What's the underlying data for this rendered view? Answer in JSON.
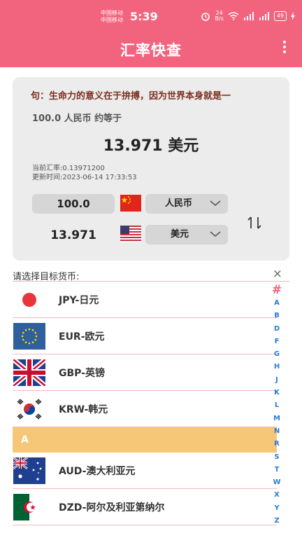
{
  "status_bar": {
    "carrier1": "中国移动",
    "carrier2": "中国移动",
    "time": "5:39",
    "speed": "24",
    "speed_unit": "B/s",
    "battery": "49"
  },
  "header": {
    "title": "汇率快查"
  },
  "card": {
    "marquee": "句：生命力的意义在于拚搏，因为世界本身就是一",
    "from_text": "100.0 人民币 约等于",
    "result": "13.971 美元",
    "rate_line": "当前汇率:0.13971200",
    "update_line": "更新时间:2023-06-14 17:33:53",
    "from_amount": "100.0",
    "from_currency": "人民币",
    "to_amount": "13.971",
    "to_currency": "美元"
  },
  "list": {
    "header": "请选择目标货币:",
    "close": "×",
    "items": [
      {
        "name": "JPY-日元",
        "flag": "japan-flag"
      },
      {
        "name": "EUR-欧元",
        "flag": "eu-flag"
      },
      {
        "name": "GBP-英镑",
        "flag": "uk-flag"
      },
      {
        "name": "KRW-韩元",
        "flag": "korea-flag"
      }
    ],
    "section": "A",
    "section_items": [
      {
        "name": "AUD-澳大利亚元",
        "flag": "australia-flag"
      },
      {
        "name": "DZD-阿尔及利亚第纳尔",
        "flag": "algeria-flag"
      }
    ]
  },
  "alphabet": [
    "#",
    "A",
    "B",
    "D",
    "F",
    "G",
    "H",
    "J",
    "K",
    "L",
    "M",
    "N",
    "R",
    "S",
    "T",
    "W",
    "X",
    "Y",
    "Z"
  ],
  "colors": {
    "brand": "#f2637e",
    "section": "#f7c778",
    "index": "#2b7bd6"
  }
}
